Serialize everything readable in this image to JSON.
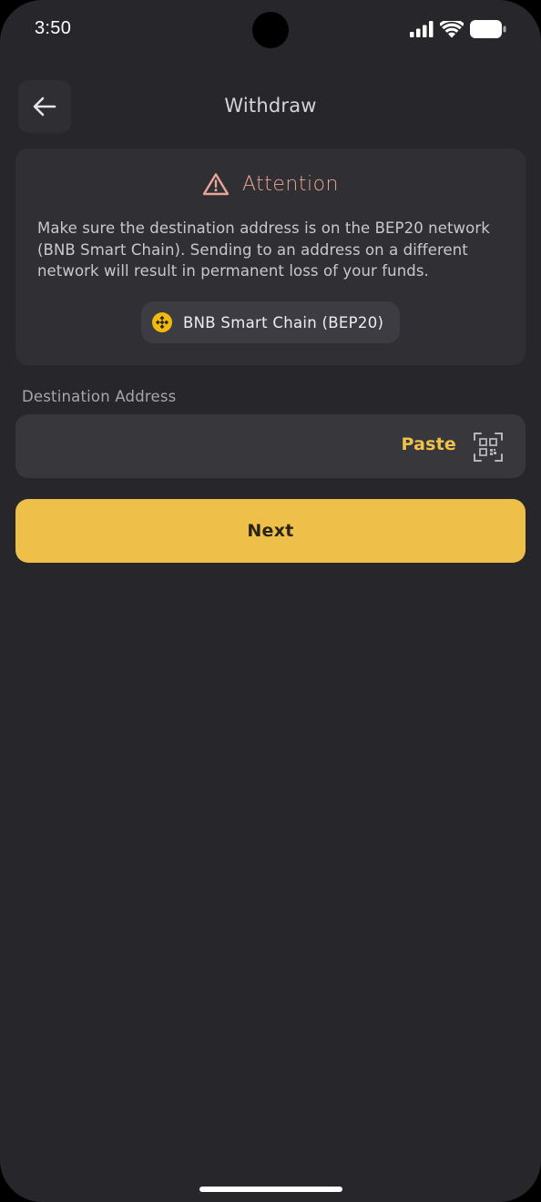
{
  "status_bar": {
    "time": "3:50",
    "icons": [
      "cellular-signal-icon",
      "wifi-icon",
      "battery-icon"
    ]
  },
  "header": {
    "title": "Withdraw",
    "back_icon": "arrow-left-icon"
  },
  "attention": {
    "icon": "warning-triangle-icon",
    "title": "Attention",
    "message": "Make sure the destination address is on the BEP20 network (BNB Smart Chain). Sending to an address on a different network will result in permanent loss of your funds.",
    "network": {
      "icon": "bnb-coin-icon",
      "label": "BNB Smart Chain (BEP20)"
    }
  },
  "destination": {
    "label": "Destination Address",
    "value": "",
    "placeholder": "",
    "paste_label": "Paste",
    "scan_icon": "qr-scan-icon"
  },
  "next_label": "Next",
  "colors": {
    "background": "#27272b",
    "card": "#2f2f34",
    "accent": "#efc049",
    "warning": "#e8a598",
    "bnb": "#f0b90b"
  }
}
